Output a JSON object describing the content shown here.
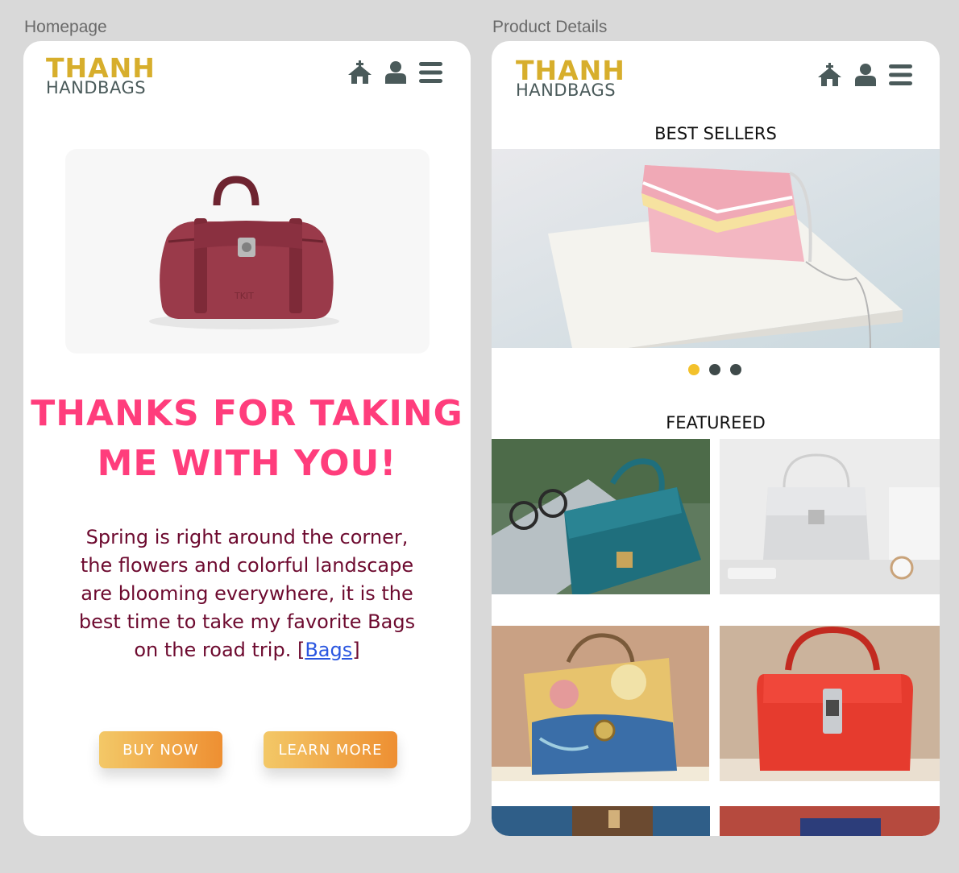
{
  "frames": {
    "home_title": "Homepage",
    "detail_title": "Product Details"
  },
  "logo": {
    "line1": "THANH",
    "line2": "HANDBAGS"
  },
  "nav": {
    "icons": [
      "home-icon",
      "user-icon",
      "menu-icon"
    ]
  },
  "home": {
    "headline_line1": "THANKS FOR TAKING",
    "headline_line2": "ME WITH YOU!",
    "body_lines": [
      "Spring is right around the corner,",
      "the flowers and colorful landscape",
      "are blooming everywhere, it is the",
      "best time to take my favorite Bags"
    ],
    "body_last_prefix": "on the road trip. [",
    "body_link": "Bags",
    "body_last_suffix": "]",
    "buy_label": "BUY NOW",
    "learn_label": "LEARN MORE"
  },
  "detail": {
    "best_sellers_title": "BEST SELLERS",
    "featured_title": "FEATUREED",
    "carousel_active_index": 0,
    "carousel_count": 3
  },
  "colors": {
    "accent_pink": "#ff3d7c",
    "logo_gold": "#d7ae2c",
    "logo_gray": "#4a5a5a",
    "body_text": "#6d0a2f",
    "link": "#2a56e0",
    "button_gradient_start": "#f3c867",
    "button_gradient_end": "#ee8f32",
    "dot_active": "#f3c12b",
    "dot_inactive": "#3f4a4a"
  }
}
